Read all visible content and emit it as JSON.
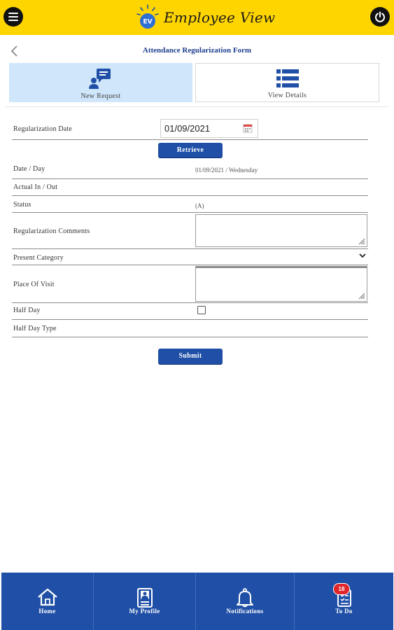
{
  "header": {
    "app_name": "Employee View",
    "logo_initials": "EV"
  },
  "page": {
    "title": "Attendance Regularization Form"
  },
  "tabs": [
    {
      "label": "New Request",
      "icon": "chat-user-icon",
      "active": true
    },
    {
      "label": "View Details",
      "icon": "list-icon",
      "active": false
    }
  ],
  "form": {
    "regularization_date_label": "Regularization Date",
    "regularization_date_value": "01/09/2021",
    "retrieve_label": "Retrieve",
    "date_day_label": "Date / Day",
    "date_day_value": "01/09/2021 / Wednesday",
    "actual_in_out_label": "Actual In / Out",
    "status_label": "Status",
    "status_value": "(A)",
    "comments_label": "Regularization Comments",
    "present_category_label": "Present Category",
    "place_of_visit_label": "Place Of Visit",
    "half_day_label": "Half Day",
    "half_day_type_label": "Half Day Type",
    "submit_label": "Submit"
  },
  "bottom_nav": [
    {
      "label": "Home",
      "icon": "home-icon"
    },
    {
      "label": "My Profile",
      "icon": "profile-icon"
    },
    {
      "label": "Notifications",
      "icon": "bell-icon"
    },
    {
      "label": "To Do",
      "icon": "todo-icon",
      "badge": "18"
    }
  ],
  "colors": {
    "header": "#ffd500",
    "accent": "#1f4fa6",
    "title": "#1c3c8c",
    "active_tab": "#cfe6fb",
    "badge": "#e0262a"
  }
}
